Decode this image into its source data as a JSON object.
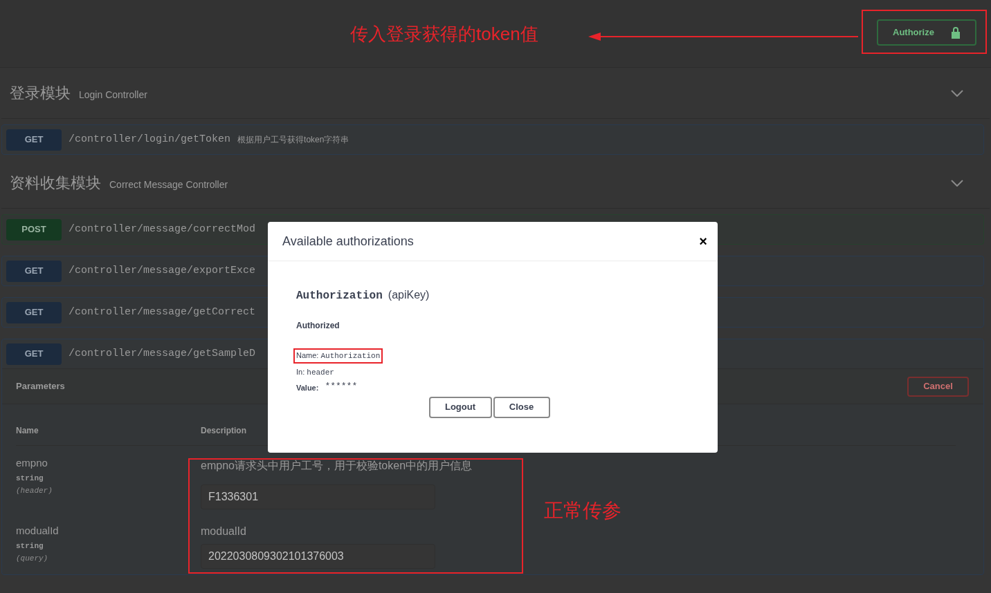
{
  "header": {
    "authorize_button": {
      "label": "Authorize"
    }
  },
  "annotations": {
    "top_note": "传入登录获得的token值",
    "param_note": "正常传参"
  },
  "sections": [
    {
      "title": "登录模块",
      "subtitle": "Login Controller",
      "operations": [
        {
          "method": "GET",
          "path": "/controller/login/getToken",
          "summary": "根据用户工号获得token字符串",
          "expanded": false
        }
      ]
    },
    {
      "title": "资料收集模块",
      "subtitle": "Correct Message Controller",
      "operations": [
        {
          "method": "POST",
          "path": "/controller/message/correctMod",
          "expanded": false
        },
        {
          "method": "GET",
          "path": "/controller/message/exportExce",
          "expanded": false
        },
        {
          "method": "GET",
          "path": "/controller/message/getCorrect",
          "expanded": false
        },
        {
          "method": "GET",
          "path": "/controller/message/getSampleD",
          "expanded": true
        }
      ]
    }
  ],
  "parameters": {
    "title": "Parameters",
    "cancel": "Cancel",
    "columns": [
      "Name",
      "Description"
    ],
    "rows": [
      {
        "name": "empno",
        "type": "string",
        "location": "(header)",
        "description": "empno请求头中用户工号，用于校验token中的用户信息",
        "value": "F1336301"
      },
      {
        "name": "modualId",
        "type": "string",
        "location": "(query)",
        "description": "modualId",
        "value": "2022030809302101376003"
      }
    ]
  },
  "modal": {
    "title": "Available authorizations",
    "close": "×",
    "scheme_name": "Authorization",
    "scheme_type": "(apiKey)",
    "status": "Authorized",
    "name": {
      "label": "Name:",
      "value": "Authorization"
    },
    "in": {
      "label": "In:",
      "value": "header"
    },
    "value": {
      "label": "Value:",
      "value": "******"
    },
    "buttons": [
      "Logout",
      "Close"
    ]
  }
}
